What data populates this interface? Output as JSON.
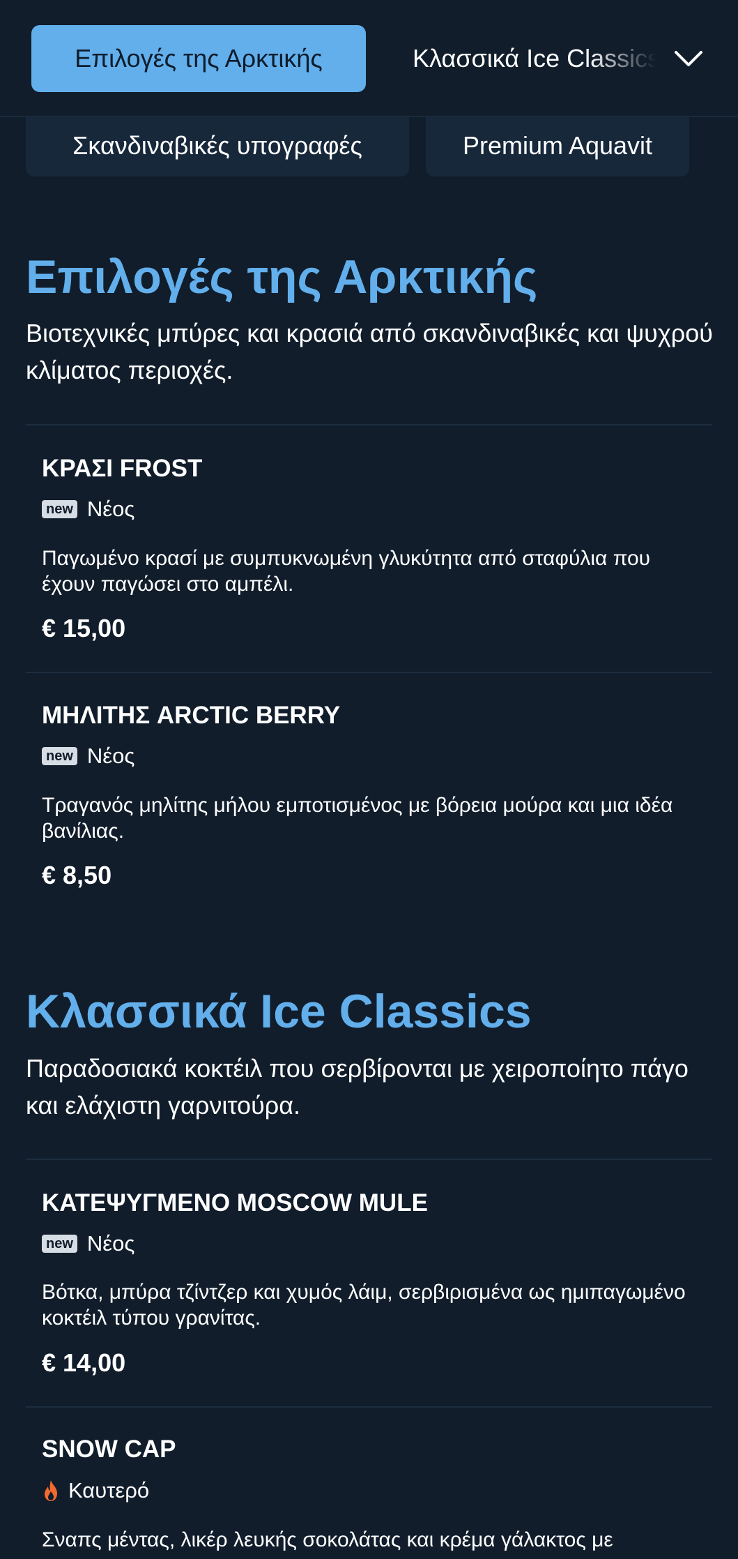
{
  "nav": {
    "active_tab": "Επιλογές της Αρκτικής",
    "next_tab": "Κλασσικά Ice Classics",
    "chips": [
      "Σκανδιναβικές υπογραφές",
      "Premium Aquavit"
    ]
  },
  "sections": [
    {
      "title": "Επιλογές της Αρκτικής",
      "description": "Βιοτεχνικές μπύρες και κρασιά από σκανδιναβικές και ψυχρού κλίματος περιοχές.",
      "items": [
        {
          "name": "ΚΡΑΣΙ FROST",
          "badge_icon": "new",
          "badge_label": "Νέος",
          "description": "Παγωμένο κρασί με συμπυκνωμένη γλυκύτητα από σταφύλια που έχουν παγώσει στο αμπέλι.",
          "price": "€ 15,00"
        },
        {
          "name": "ΜΗΛΙΤΗΣ ARCTIC BERRY",
          "badge_icon": "new",
          "badge_label": "Νέος",
          "description": "Τραγανός μηλίτης μήλου εμποτισμένος με βόρεια μούρα και μια ιδέα βανίλιας.",
          "price": "€ 8,50"
        }
      ]
    },
    {
      "title": "Κλασσικά Ice Classics",
      "description": "Παραδοσιακά κοκτέιλ που σερβίρονται με χειροποίητο πάγο και ελάχιστη γαρνιτούρα.",
      "items": [
        {
          "name": "ΚΑΤΕΨΥΓΜΕΝΟ MOSCOW MULE",
          "badge_icon": "new",
          "badge_label": "Νέος",
          "description": "Βότκα, μπύρα τζίντζερ και χυμός λάιμ, σερβιρισμένα ως ημιπαγωμένο κοκτέιλ τύπου γρανίτας.",
          "price": "€ 14,00"
        },
        {
          "name": "SNOW CAP",
          "badge_icon": "flame-icon",
          "badge_label": "Καυτερό",
          "description": "Σναπς μέντας, λικέρ λευκής σοκολάτας και κρέμα γάλακτος με"
        }
      ]
    }
  ],
  "colors": {
    "background": "#111d2b",
    "accent": "#62afec",
    "chip": "#17283b",
    "flame": "#f26a2e"
  }
}
